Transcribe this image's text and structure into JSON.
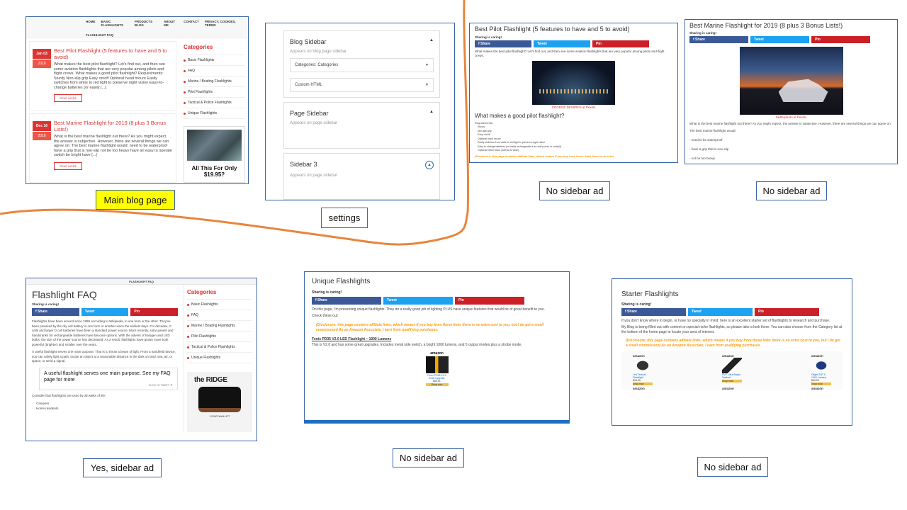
{
  "captions": {
    "main_blog": "Main blog page",
    "settings": "settings",
    "no_ad_1": "No sidebar ad",
    "no_ad_2": "No sidebar ad",
    "yes_ad": "Yes, sidebar ad",
    "no_ad_3": "No sidebar ad",
    "no_ad_4": "No sidebar ad"
  },
  "main_blog": {
    "nav": [
      "HOME",
      "BASIC FLASHLIGHTS",
      "PRODUCTS BLOG",
      "ABOUT ME",
      "CONTACT",
      "PRIVACY, COOKIES, TERMS"
    ],
    "nav_second": "FLASHLIGHT FAQ",
    "posts": [
      {
        "day": "Jan 03",
        "year": "2019",
        "title": "Best Pilot Flashlight (5 features to have and 5 to avoid)",
        "excerpt": "What makes the best pilot flashlight? Let's find out, and then see some aviation flashlights that are very popular among pilots and flight crews.  What makes a good pilot flashlight? Requirements: Sturdy Non-slip grip Easy on/off Optional head mount Easily switches from white to red light to preserve night vision Easy-to-change batteries (or easily [...]",
        "read_more": "READ MORE"
      },
      {
        "day": "Dec 16",
        "year": "2018",
        "title": "Best Marine Flashlight for 2019 (8 plus 3 Bonus Lists!)",
        "excerpt": "What is the best marine flashlight out there? As you might expect, the answer is subjective. However, there are several things we can agree on: The best marine flashlight would: need to be waterproof have a grip that is non-slip not be too heavy have an easy to operate switch be bright have [...]",
        "read_more": "READ MORE"
      }
    ],
    "sidebar_title": "Categories",
    "categories": [
      "Basic Flashlights",
      "FAQ",
      "Marine / Boating Flashlights",
      "Pilot Flashlights",
      "Tactical & Police Flashlights",
      "Unique Flashlights"
    ],
    "ad_text": "All This For Only",
    "ad_price": "$19.95?"
  },
  "settings": {
    "widgets": [
      {
        "title": "Blog Sidebar",
        "sub": "Appears on blog page sidebar",
        "items": [
          "Categories: Categories",
          "Custom HTML"
        ],
        "toggle": "▲"
      },
      {
        "title": "Page Sidebar",
        "sub": "Appears on page sidebar",
        "items": [],
        "toggle": "▲"
      },
      {
        "title": "Sidebar 3",
        "sub": "Appears on page sidebar",
        "items": [],
        "toggle": "▲"
      }
    ],
    "item_arrow": "▼"
  },
  "share": {
    "fb": "f  Share",
    "tw": "Tweet",
    "pin": "Pin",
    "caring": "Sharing is caring!"
  },
  "pilot": {
    "title": "Best Pilot Flashlight (5 features to have and 5 to avoid)",
    "intro": "What makes the best pilot flashlight? Let's find out, and then see some aviation flashlights that are very popular among pilots and flight crews.",
    "credit": "GEORGE DESIPRIS at Pexels",
    "h2": "What makes a good pilot flashlight?",
    "req": "Requirements:",
    "list": [
      "Sturdy",
      "Non-slip grip",
      "Easy on/off",
      "Optional head mount",
      "Easily switches from white to red light to preserve night vision",
      "Easy-to-change batteries (or easily rechargeable from wall power or cockpit)",
      "Optional beam focus (narrow to wide)"
    ],
    "disclosure": "(Disclosure: this page contains affiliate links, which means if you buy from those links there is no extra"
  },
  "marine": {
    "title": "Best Marine Flashlight for 2019 (8 plus 3 Bonus Lists!)",
    "credit": "Skitterphoto at Pexels",
    "intro": "What is the best marine flashlight out there? As you might expect, the answer is subjective. However, there are several things we can agree on:",
    "would": "The best marine flashlight would:",
    "list": [
      "- need to be waterproof",
      "- have a grip that is non-slip",
      "- not be too heavy"
    ]
  },
  "faq": {
    "topbar": "FLASHLIGHT FAQ",
    "title": "Flashlight FAQ",
    "p1": "Flashlights have been around since 1899 according to Wikipedia, in one form or the other. They've been powered by the dry cell battery in one form or another since the earliest days. For decades, C cells and larger D cell batteries have been a standard power source. More recently, solar panels and handcranks for rechargeable batteries have become options. With the advent of halogen and LED bulbs, the size of the power source has decreased. As a result, flashlights have grown more both powerful (brighter) and smaller over the years.",
    "p2": "A useful flashlight serves one main purpose. That is to throw a beam of light. From a handheld device, you can safely light a path, locate an object at a reasonable distance in the dark on land, sea, air, or space; or send a signal.",
    "tweet": "A useful flashlight serves one main purpose. See my FAQ page for more",
    "tweet_cta": "CLICK TO TWEET",
    "p3": "Consider that flashlights are used by all walks of life:",
    "list": [
      "Campers",
      "Home residents"
    ],
    "ad_brand": "the RIDGE",
    "ad_caption": "YOUR WALLET"
  },
  "unique": {
    "title": "Unique Flashlights",
    "p1": "On this page, I'm presenting unique flashlights. They do a really good job of lighting PLUS have unique features that would be of great benefit to you.",
    "check": "Check these out:",
    "disclosure": "(Disclosure: this page contains affiliate links, which means if you buy from those links there is no extra cost to you, but I do get a small commission)  As an Amazon Associate, I earn from qualifying purchases.",
    "product": "Fenix PD35 V2.0 LED Flashlight – 1000 Lumens",
    "desc": "This is V2.0 and has some great upgrades. Includes metal side switch, a bright 1000 lumens, and 5 output modes plus a strobe mode.",
    "amazon": "amazon",
    "prod_name": "Fenix PD35 V2.0 2018 Upgrade",
    "prod_price": "$65.51",
    "shop": "Shop now"
  },
  "starter": {
    "title": "Starter Flashlights",
    "p1": "If you don't know where to begin, or have no specialty in mind, here is an excellent starter set of flashlights to research and purchase.",
    "p2": "My Blog is being filled out with content on special niche flashlights, so please take a look there. You can also choose from the Category list at the bottom of the home page to locate your area of interest.",
    "disclosure": "(Disclosure: this page contains affiliate links, which means if you buy from those links there is no extra cost to you, but I do get a small commission)  As an Amazon Associate, I earn from qualifying purchases.",
    "products": [
      {
        "name": "Led Tactical Flashlight",
        "price": "$13.99"
      },
      {
        "name": "EVC Ultra Bright Tactical",
        "price": ""
      },
      {
        "name": "Olight S1R II 1000 Lumens",
        "price": "$49.99"
      }
    ],
    "amazon": "amazon",
    "shop": "Shop now"
  },
  "colors": {
    "accent_red": "#dd3333",
    "frame_blue": "#3a66a7",
    "divider_orange": "#e8853c",
    "fb": "#3b5998",
    "tw": "#1da1f2",
    "pin": "#cb2027"
  }
}
